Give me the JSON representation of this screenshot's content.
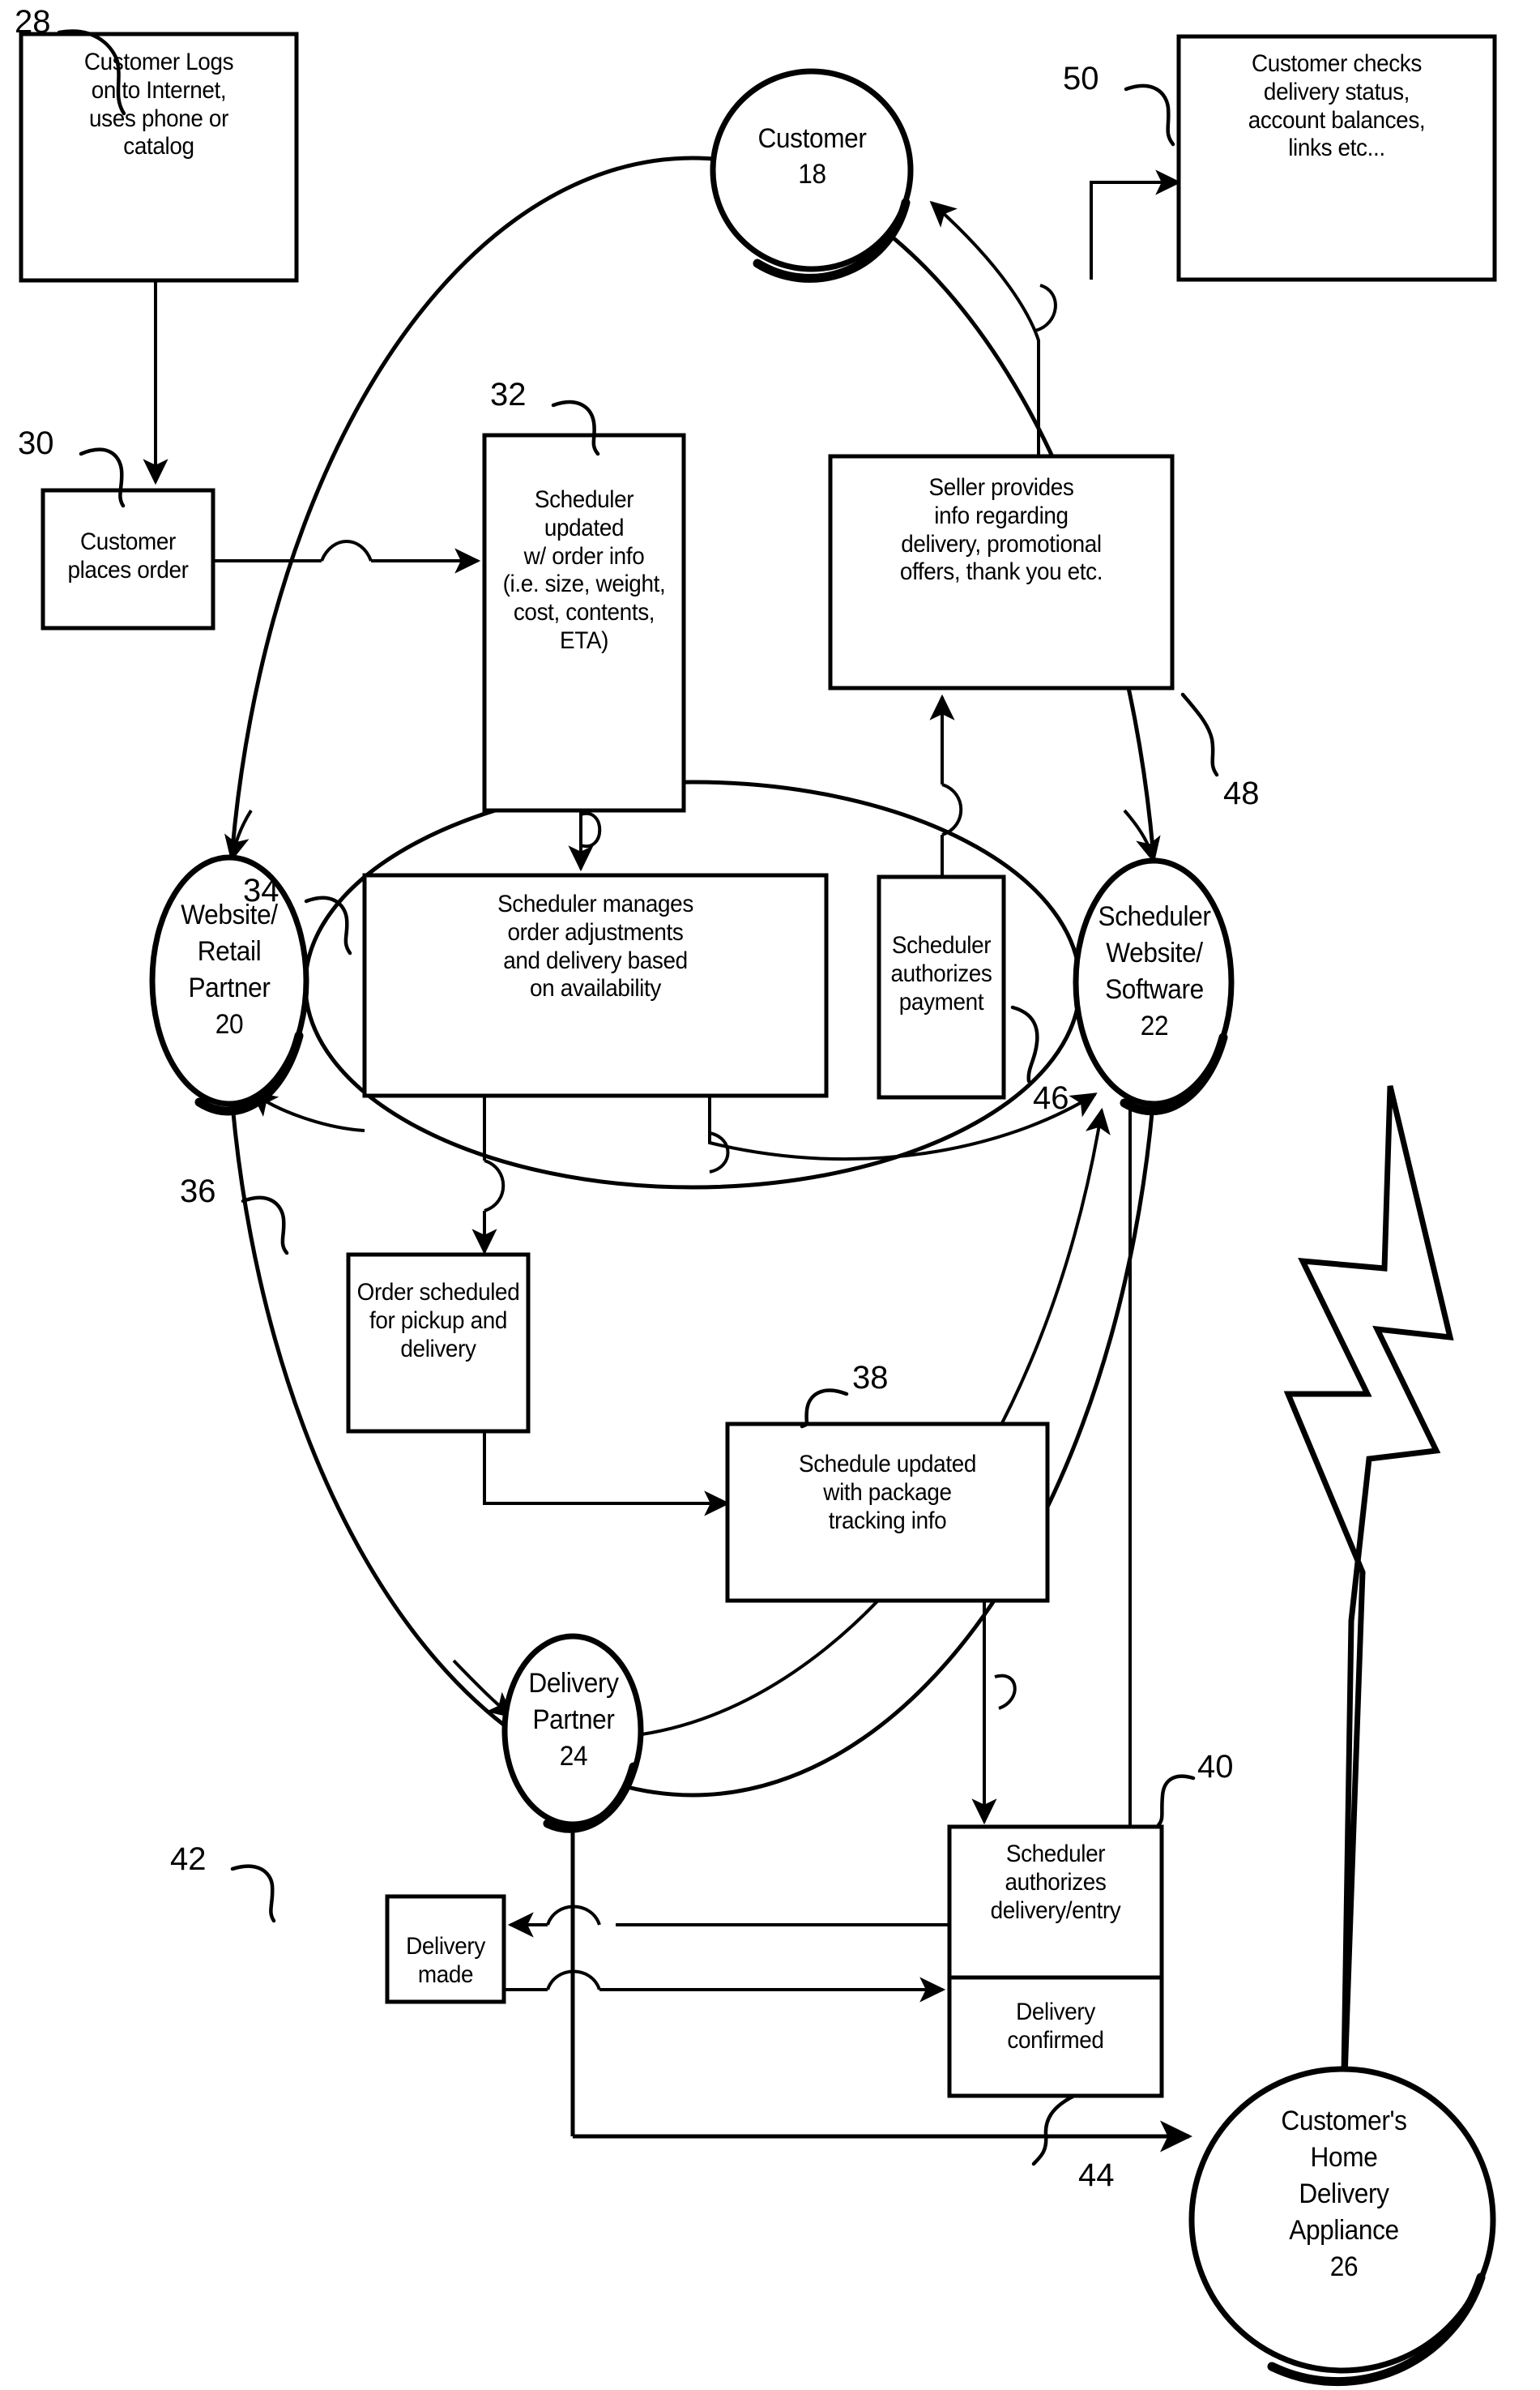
{
  "figure": {
    "type": "patent-flow-diagram",
    "background": "#ffffff",
    "line_color": "#000000"
  },
  "nodes": [
    {
      "ref": "18",
      "label": "Customer",
      "shape": "circle",
      "lines": [
        "Customer",
        "18"
      ]
    },
    {
      "ref": "20",
      "label": "Website/Retail Partner",
      "shape": "ellipse",
      "lines": [
        "Website/",
        "Retail",
        "Partner",
        "20"
      ]
    },
    {
      "ref": "22",
      "label": "Scheduler Website/Software",
      "shape": "ellipse",
      "lines": [
        "Scheduler",
        "Website/",
        "Software",
        "22"
      ]
    },
    {
      "ref": "24",
      "label": "Delivery Partner",
      "shape": "ellipse",
      "lines": [
        "Delivery",
        "Partner",
        "24"
      ]
    },
    {
      "ref": "26",
      "label": "Customer's Home Delivery Appliance",
      "shape": "circle",
      "lines": [
        "Customer's",
        "Home",
        "Delivery",
        "Appliance",
        "26"
      ]
    }
  ],
  "boxes": [
    {
      "ref": "28",
      "text": "Customer Logs\non to Internet,\nuses phone or\ncatalog"
    },
    {
      "ref": "30",
      "text": "Customer\nplaces order"
    },
    {
      "ref": "32",
      "text": "Scheduler updated\nw/ order info\n(i.e. size, weight,\ncost, contents, ETA)"
    },
    {
      "ref": "34",
      "text": "Scheduler manages\norder adjustments\nand delivery based\non availability"
    },
    {
      "ref": "36",
      "text": "Order scheduled\nfor pickup and\ndelivery"
    },
    {
      "ref": "38",
      "text": "Schedule updated\nwith package\ntracking info"
    },
    {
      "ref": "40",
      "text": "Scheduler\nauthorizes\ndelivery/entry"
    },
    {
      "ref": "42",
      "text": "Delivery made"
    },
    {
      "ref": "44",
      "text": "Delivery\nconfirmed"
    },
    {
      "ref": "46",
      "text": "Scheduler\nauthorizes\npayment"
    },
    {
      "ref": "48",
      "text": "Seller provides\ninfo regarding\ndelivery, promotional\noffers, thank you etc."
    },
    {
      "ref": "50",
      "text": "Customer checks\ndelivery status,\naccount balances,\nlinks etc..."
    }
  ],
  "reference_numerals": [
    "18",
    "20",
    "22",
    "24",
    "26",
    "28",
    "30",
    "32",
    "34",
    "36",
    "38",
    "40",
    "42",
    "44",
    "46",
    "48",
    "50"
  ],
  "symbols": [
    {
      "name": "wireless-lightning-bolt",
      "between": [
        "22",
        "26"
      ]
    }
  ]
}
